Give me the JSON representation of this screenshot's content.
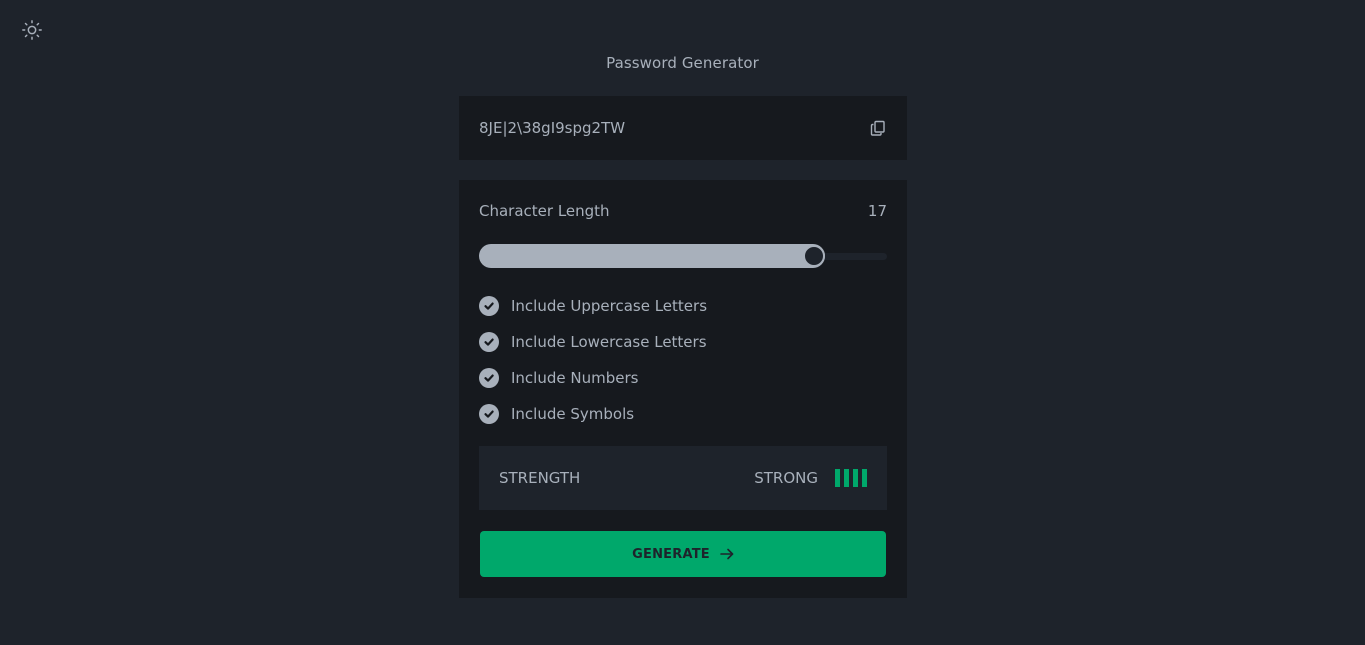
{
  "header": {
    "theme_icon": "sun-icon",
    "title": "Password Generator"
  },
  "output": {
    "password": "8JE|2\\38gI9spg2TW",
    "copy_icon": "copy-icon"
  },
  "length": {
    "label": "Character Length",
    "value": "17",
    "slider_fraction": 0.83
  },
  "options": [
    {
      "label": "Include Uppercase Letters",
      "checked": true
    },
    {
      "label": "Include Lowercase Letters",
      "checked": true
    },
    {
      "label": "Include Numbers",
      "checked": true
    },
    {
      "label": "Include Symbols",
      "checked": true
    }
  ],
  "strength": {
    "label": "STRENGTH",
    "level_text": "STRONG",
    "bars_filled": 4,
    "bars_total": 4
  },
  "generate": {
    "label": "GENERATE",
    "icon": "arrow-right-icon"
  },
  "colors": {
    "background": "#1e232b",
    "panel": "#16191e",
    "text": "#a8b0bb",
    "accent": "#00a86b",
    "button_text": "#1e232b"
  }
}
